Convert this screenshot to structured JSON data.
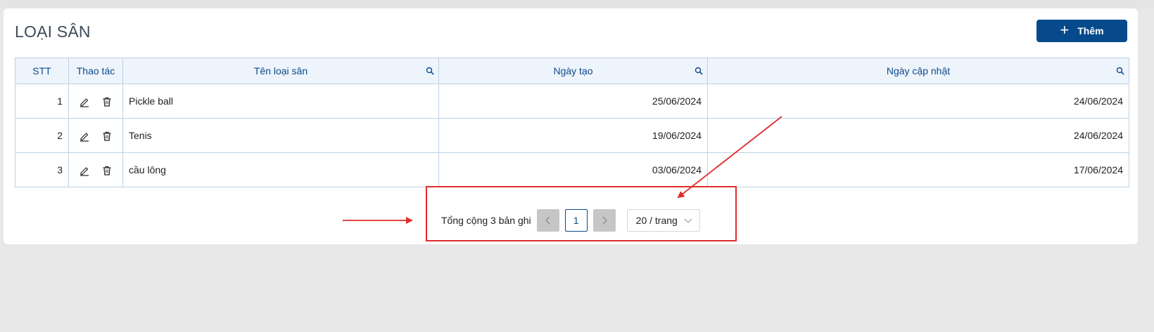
{
  "header": {
    "title": "LOẠI SÂN"
  },
  "toolbar": {
    "add_label": "Thêm",
    "add_icon": "plus-icon"
  },
  "table": {
    "columns": [
      "STT",
      "Thao tác",
      "Tên loại sân",
      "Ngày tạo",
      "Ngày cập nhật"
    ],
    "rows": [
      {
        "stt": "1",
        "name": "Pickle ball",
        "created": "25/06/2024",
        "updated": "24/06/2024"
      },
      {
        "stt": "2",
        "name": "Tenis",
        "created": "19/06/2024",
        "updated": "24/06/2024"
      },
      {
        "stt": "3",
        "name": "cầu lông",
        "created": "03/06/2024",
        "updated": "17/06/2024"
      }
    ]
  },
  "pagination": {
    "total_text": "Tổng cộng 3 bản ghi",
    "current_page": "1",
    "page_size": "20 / trang"
  },
  "colors": {
    "accent": "#064a8c",
    "header_bg": "#eef4fb",
    "annotation": "#e12b2b"
  }
}
